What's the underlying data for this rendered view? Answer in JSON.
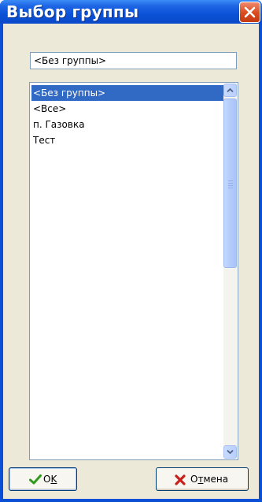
{
  "window": {
    "title": "Выбор группы",
    "close_icon": "close-icon",
    "title_bar_color": "#0a4fd6",
    "client_color": "#ece9d8"
  },
  "selected_group": {
    "value": "<Без группы>"
  },
  "group_list": {
    "items": [
      "<Без группы>",
      "<Все>",
      "п. Газовка",
      "Тест"
    ],
    "selected_index": 0,
    "selection_color": "#316ac5"
  },
  "buttons": {
    "ok_label_pre": "O",
    "ok_label_mnemonic": "K",
    "ok_icon": "check-icon",
    "cancel_label_pre": "О",
    "cancel_label_mnemonic": "т",
    "cancel_label_post": "мена",
    "cancel_icon": "x-icon"
  }
}
